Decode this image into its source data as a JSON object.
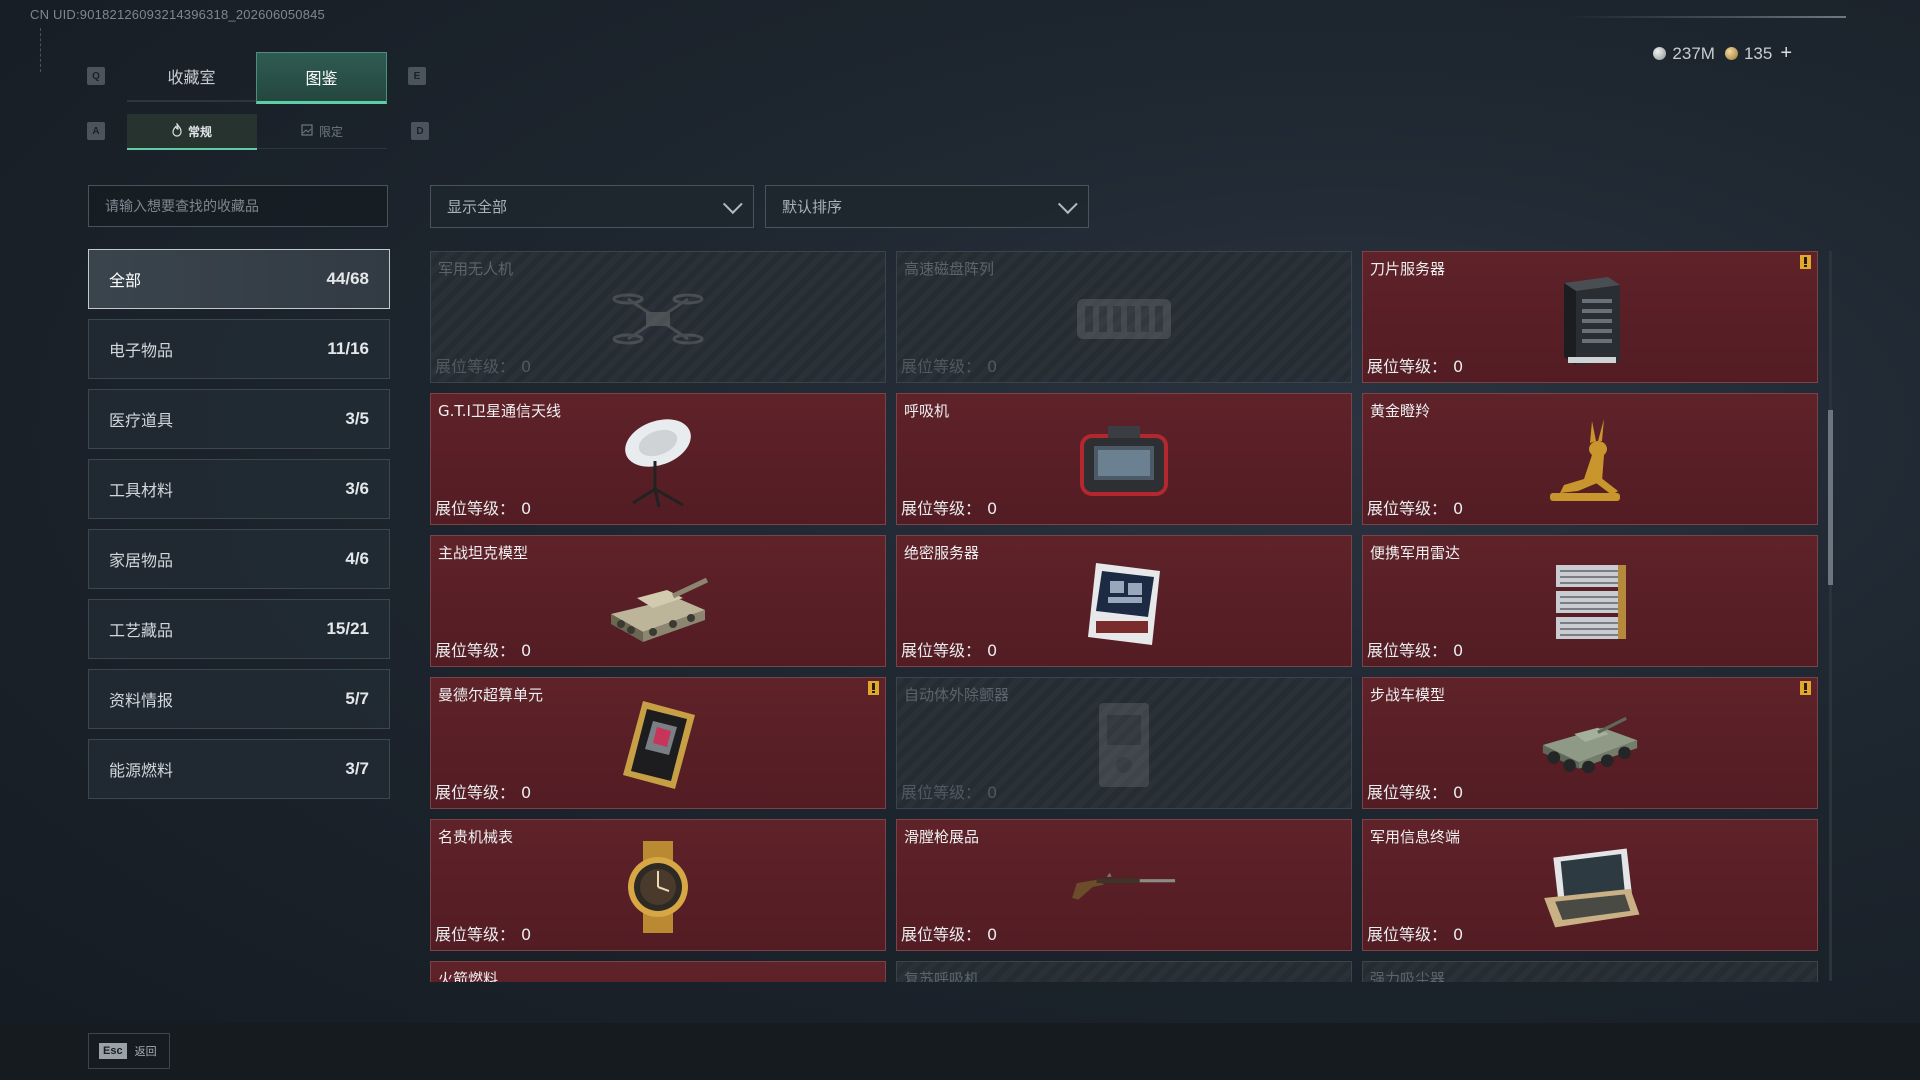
{
  "uid": "CN UID:90182126093214396318_202606050845",
  "keys": {
    "prev_tab": "Q",
    "next_tab": "E",
    "prev_sub": "A",
    "next_sub": "D"
  },
  "tabs": [
    {
      "label": "收藏室",
      "active": false
    },
    {
      "label": "图鉴",
      "active": true
    }
  ],
  "subtabs": [
    {
      "label": "常规",
      "active": true
    },
    {
      "label": "限定",
      "active": false
    }
  ],
  "currency": {
    "silver": "237M",
    "gold": "135",
    "add": "+"
  },
  "search": {
    "placeholder": "请输入想要查找的收藏品"
  },
  "filter": {
    "value": "显示全部"
  },
  "sort": {
    "value": "默认排序"
  },
  "categories": [
    {
      "label": "全部",
      "count": "44/68",
      "active": true
    },
    {
      "label": "电子物品",
      "count": "11/16"
    },
    {
      "label": "医疗道具",
      "count": "3/5"
    },
    {
      "label": "工具材料",
      "count": "3/6"
    },
    {
      "label": "家居物品",
      "count": "4/6"
    },
    {
      "label": "工艺藏品",
      "count": "15/21"
    },
    {
      "label": "资料情报",
      "count": "5/7"
    },
    {
      "label": "能源燃料",
      "count": "3/7"
    }
  ],
  "level_label": "展位等级：",
  "items": [
    {
      "name": "军用无人机",
      "level": "0",
      "locked": true,
      "icon": "drone-icon"
    },
    {
      "name": "高速磁盘阵列",
      "level": "0",
      "locked": true,
      "icon": "disk-array-icon"
    },
    {
      "name": "刀片服务器",
      "level": "0",
      "locked": false,
      "alert": true,
      "icon": "blade-server-icon"
    },
    {
      "name": "G.T.I卫星通信天线",
      "level": "0",
      "locked": false,
      "icon": "satellite-dish-icon"
    },
    {
      "name": "呼吸机",
      "level": "0",
      "locked": false,
      "icon": "ventilator-icon"
    },
    {
      "name": "黄金瞪羚",
      "level": "0",
      "locked": false,
      "icon": "golden-gazelle-icon"
    },
    {
      "name": "主战坦克模型",
      "level": "0",
      "locked": false,
      "icon": "tank-model-icon"
    },
    {
      "name": "绝密服务器",
      "level": "0",
      "locked": false,
      "icon": "secret-server-icon"
    },
    {
      "name": "便携军用雷达",
      "level": "0",
      "locked": false,
      "icon": "portable-radar-icon"
    },
    {
      "name": "曼德尔超算单元",
      "level": "0",
      "locked": false,
      "alert": true,
      "icon": "compute-unit-icon"
    },
    {
      "name": "自动体外除颤器",
      "level": "0",
      "locked": true,
      "icon": "defibrillator-icon"
    },
    {
      "name": "步战车模型",
      "level": "0",
      "locked": false,
      "alert": true,
      "icon": "ifv-model-icon"
    },
    {
      "name": "名贵机械表",
      "level": "0",
      "locked": false,
      "icon": "watch-icon"
    },
    {
      "name": "滑膛枪展品",
      "level": "0",
      "locked": false,
      "icon": "musket-icon"
    },
    {
      "name": "军用信息终端",
      "level": "0",
      "locked": false,
      "icon": "military-terminal-icon"
    },
    {
      "name": "火箭燃料",
      "level": "",
      "locked": false,
      "icon": "rocket-fuel-icon"
    },
    {
      "name": "复苏呼吸机",
      "level": "",
      "locked": true,
      "icon": "resuscitator-icon"
    },
    {
      "name": "强力吸尘器",
      "level": "",
      "locked": true,
      "icon": "vacuum-icon"
    }
  ],
  "footer": {
    "esc_key": "Esc",
    "back_label": "返回"
  }
}
